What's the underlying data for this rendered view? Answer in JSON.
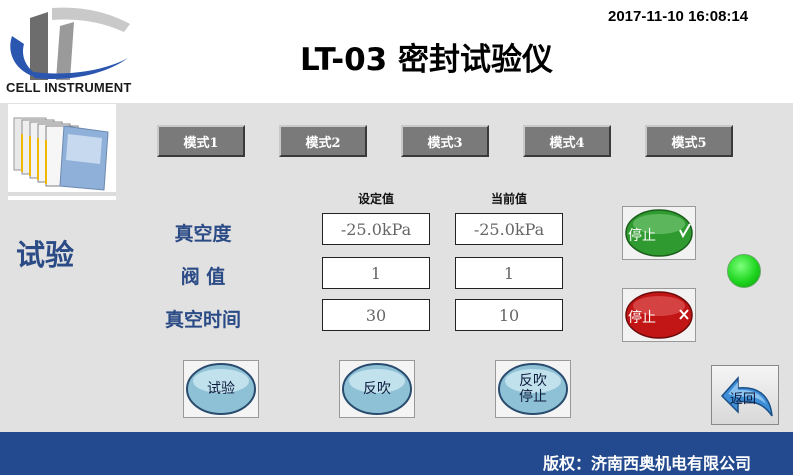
{
  "header": {
    "company_logo_text": "CELL INSTRUMENT",
    "title": "LT-03 密封试验仪",
    "datetime": "2017-11-10 16:08:14"
  },
  "modes": [
    {
      "label": "模式1"
    },
    {
      "label": "模式2"
    },
    {
      "label": "模式3"
    },
    {
      "label": "模式4"
    },
    {
      "label": "模式5"
    }
  ],
  "section": {
    "title": "试验"
  },
  "columns": {
    "set_value": "设定值",
    "current_value": "当前值"
  },
  "rows": [
    {
      "label": "真空度",
      "set": "-25.0kPa",
      "current": "-25.0kPa"
    },
    {
      "label": "阀 值",
      "set": "1",
      "current": "1"
    },
    {
      "label": "真空时间",
      "set": "30",
      "current": "10"
    }
  ],
  "buttons": {
    "test": "试验",
    "blow": "反吹",
    "blow_stop_line1": "反吹",
    "blow_stop_line2": "停止",
    "stop_ok": "停止",
    "stop_cancel": "停止",
    "back": "返回"
  },
  "colors": {
    "accent_blue": "#2a4b86",
    "footer_blue": "#234a8e",
    "indicator_green": "#1fd61f"
  },
  "footer": {
    "copyright": "版权：济南西奥机电有限公司"
  }
}
